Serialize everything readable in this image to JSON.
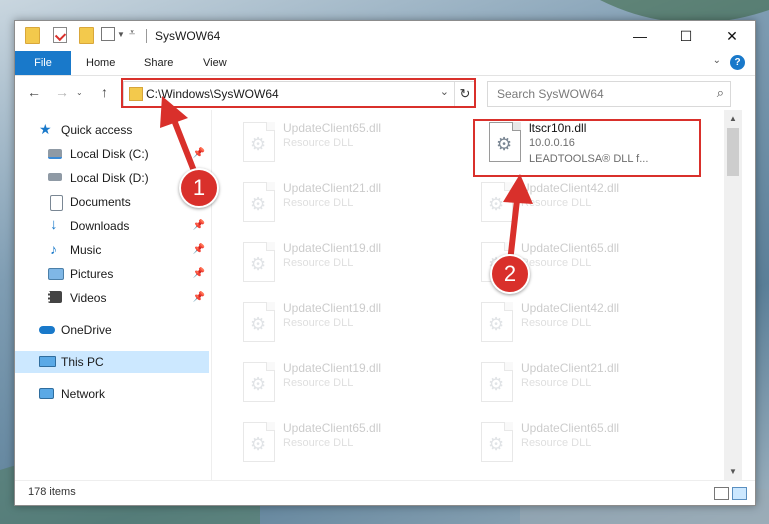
{
  "window": {
    "title": "SysWOW64",
    "minimize_glyph": "—",
    "maximize_glyph": "☐",
    "close_glyph": "✕",
    "quick_access_icons": [
      "folder-icon",
      "properties-icon",
      "new-folder-icon",
      "customize-icon"
    ]
  },
  "ribbon": {
    "tabs": [
      "File",
      "Home",
      "Share",
      "View"
    ],
    "help_glyph": "?"
  },
  "nav": {
    "back": "←",
    "forward": "→",
    "up": "↑",
    "address_path": "C:\\Windows\\SysWOW64",
    "address_dropdown": "⌄",
    "refresh": "↻",
    "search_placeholder": "Search SysWOW64",
    "search_glyph": "⌕"
  },
  "sidebar": {
    "pin_glyph": "📌",
    "items": [
      {
        "label": "Quick access",
        "icon": "star-icon",
        "pinned": false
      },
      {
        "label": "Local Disk (C:)",
        "icon": "drive-icon",
        "pinned": true
      },
      {
        "label": "Local Disk (D:)",
        "icon": "drive-icon",
        "pinned": false
      },
      {
        "label": "Documents",
        "icon": "documents-icon",
        "pinned": true
      },
      {
        "label": "Downloads",
        "icon": "downloads-icon",
        "pinned": true
      },
      {
        "label": "Music",
        "icon": "music-icon",
        "pinned": true
      },
      {
        "label": "Pictures",
        "icon": "pictures-icon",
        "pinned": true
      },
      {
        "label": "Videos",
        "icon": "videos-icon",
        "pinned": true
      },
      {
        "label": "OneDrive",
        "icon": "onedrive-icon",
        "pinned": false
      },
      {
        "label": "This PC",
        "icon": "computer-icon",
        "pinned": false
      },
      {
        "label": "Network",
        "icon": "network-icon",
        "pinned": false
      }
    ]
  },
  "files": {
    "highlighted": {
      "name": "ltscr10n.dll",
      "version": "10.0.0.16",
      "description": "LEADTOOLSA® DLL f..."
    },
    "faded_left": [
      {
        "name": "UpdateClient65.dll",
        "type": "Resource DLL"
      },
      {
        "name": "UpdateClient21.dll",
        "type": "Resource DLL"
      },
      {
        "name": "UpdateClient19.dll",
        "type": "Resource DLL"
      },
      {
        "name": "UpdateClient19.dll",
        "type": "Resource DLL"
      },
      {
        "name": "UpdateClient19.dll",
        "type": "Resource DLL"
      },
      {
        "name": "UpdateClient65.dll",
        "type": "Resource DLL"
      }
    ],
    "faded_right": [
      {
        "name": "UpdateClient42.dll",
        "type": "Resource DLL"
      },
      {
        "name": "UpdateClient65.dll",
        "type": "Resource DLL"
      },
      {
        "name": "UpdateClient42.dll",
        "type": "Resource DLL"
      },
      {
        "name": "UpdateClient21.dll",
        "type": "Resource DLL"
      },
      {
        "name": "UpdateClient65.dll",
        "type": "Resource DLL"
      }
    ]
  },
  "status": {
    "item_count": "178 items"
  },
  "annotations": {
    "step1": "1",
    "step2": "2",
    "highlight_color": "#d9302b"
  },
  "colors": {
    "ribbon_file": "#1979ca",
    "selected_nav": "#cce8ff"
  }
}
